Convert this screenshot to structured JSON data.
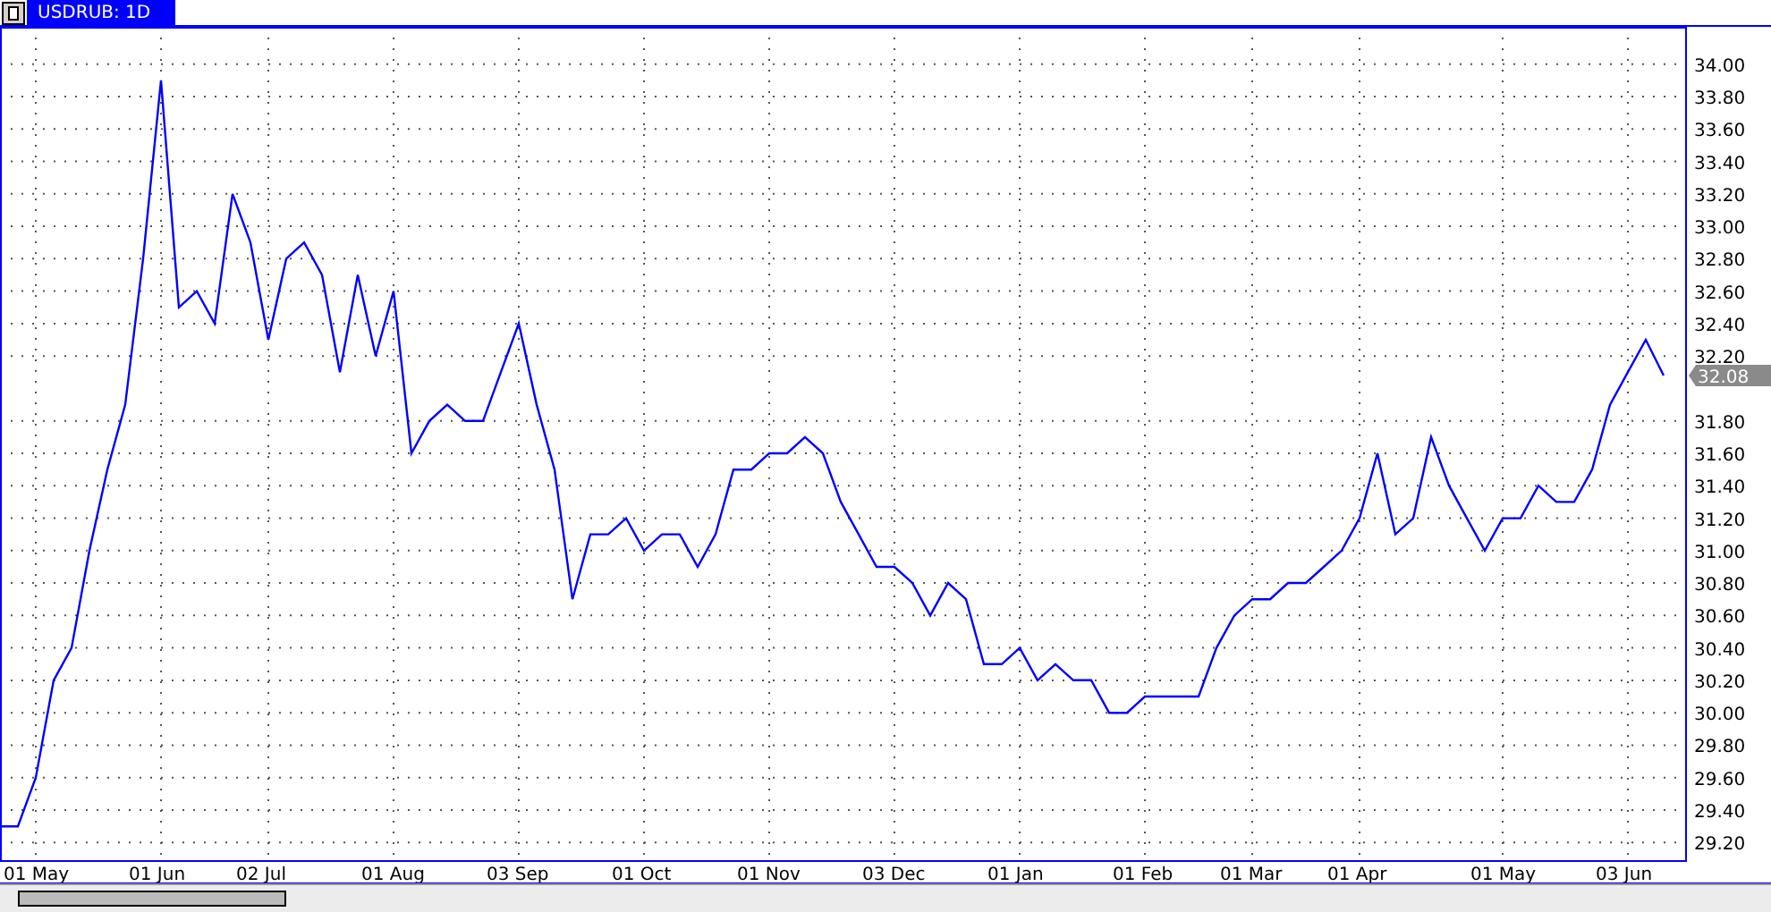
{
  "tab": {
    "label": "USDRUB: 1D",
    "selected": true
  },
  "chart": {
    "last_price": "32.08",
    "chart_data": {
      "type": "line",
      "categories": [
        null,
        null,
        "01 May",
        null,
        null,
        null,
        null,
        null,
        null,
        "01 Jun",
        null,
        null,
        null,
        null,
        null,
        "02 Jul",
        null,
        null,
        null,
        null,
        null,
        null,
        "01 Aug",
        null,
        null,
        null,
        null,
        null,
        null,
        "03 Sep",
        null,
        null,
        null,
        null,
        null,
        null,
        "01 Oct",
        null,
        null,
        null,
        null,
        null,
        null,
        "01 Nov",
        null,
        null,
        null,
        null,
        null,
        null,
        "03 Dec",
        null,
        null,
        null,
        null,
        null,
        null,
        "01 Jan",
        null,
        null,
        null,
        null,
        null,
        null,
        "01 Feb",
        null,
        null,
        null,
        null,
        null,
        "01 Mar",
        null,
        null,
        null,
        null,
        null,
        "01 Apr",
        null,
        null,
        null,
        null,
        null,
        null,
        null,
        "01 May",
        null,
        null,
        null,
        null,
        null,
        null,
        "03 Jun",
        null,
        null
      ],
      "series": [
        {
          "color": "#0000ff",
          "values": [
            29.3,
            29.3,
            29.6,
            30.2,
            30.4,
            31.0,
            31.5,
            31.9,
            32.8,
            33.9,
            32.5,
            32.6,
            32.4,
            33.2,
            32.9,
            32.3,
            32.8,
            32.9,
            32.7,
            32.1,
            32.7,
            32.2,
            32.6,
            31.6,
            31.8,
            31.9,
            31.8,
            31.8,
            32.1,
            32.4,
            31.9,
            31.5,
            30.7,
            31.1,
            31.1,
            31.2,
            31.0,
            31.1,
            31.1,
            30.9,
            31.1,
            31.5,
            31.5,
            31.6,
            31.6,
            31.7,
            31.6,
            31.3,
            31.1,
            30.9,
            30.9,
            30.8,
            30.6,
            30.8,
            30.7,
            30.3,
            30.3,
            30.4,
            30.2,
            30.3,
            30.2,
            30.2,
            30.0,
            30.0,
            30.1,
            30.1,
            30.1,
            30.1,
            30.4,
            30.6,
            30.7,
            30.7,
            30.8,
            30.8,
            30.9,
            31.0,
            31.2,
            31.6,
            31.1,
            31.2,
            31.7,
            31.4,
            31.2,
            31.0,
            31.2,
            31.2,
            31.4,
            31.3,
            31.3,
            31.5,
            31.9,
            32.1,
            32.3,
            32.08
          ]
        }
      ],
      "grid": true,
      "ylim": [
        29.08,
        34.23
      ],
      "yticks": [
        {
          "value": 29.2,
          "label": "29.20"
        },
        {
          "value": 29.4,
          "label": "29.40"
        },
        {
          "value": 29.6,
          "label": "29.60"
        },
        {
          "value": 29.8,
          "label": "29.80"
        },
        {
          "value": 30,
          "label": "30.00"
        },
        {
          "value": 30.2,
          "label": "30.20"
        },
        {
          "value": 30.4,
          "label": "30.40"
        },
        {
          "value": 30.6,
          "label": "30.60"
        },
        {
          "value": 30.8,
          "label": "30.80"
        },
        {
          "value": 31,
          "label": "31.00"
        },
        {
          "value": 31.2,
          "label": "31.20"
        },
        {
          "value": 31.4,
          "label": "31.40"
        },
        {
          "value": 31.6,
          "label": "31.60"
        },
        {
          "value": 31.8,
          "label": "31.80"
        },
        {
          "value": 32.2,
          "label": "32.20"
        },
        {
          "value": 32.4,
          "label": "32.40"
        },
        {
          "value": 32.6,
          "label": "32.60"
        },
        {
          "value": 32.8,
          "label": "32.80"
        },
        {
          "value": 33,
          "label": "33.00"
        },
        {
          "value": 33.2,
          "label": "33.20"
        },
        {
          "value": 33.4,
          "label": "33.40"
        },
        {
          "value": 33.6,
          "label": "33.60"
        },
        {
          "value": 33.8,
          "label": "33.80"
        },
        {
          "value": 34,
          "label": "34.00"
        }
      ]
    }
  }
}
